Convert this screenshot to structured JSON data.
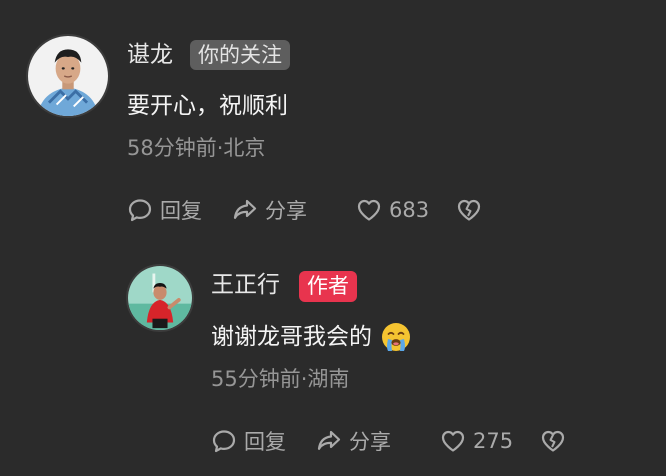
{
  "comments": [
    {
      "user_name": "谌龙",
      "badge": "你的关注",
      "text": "要开心，祝顺利",
      "time": "58分钟前",
      "location": "北京",
      "actions": {
        "reply_label": "回复",
        "share_label": "分享",
        "like_count": "683"
      }
    }
  ],
  "replies": [
    {
      "user_name": "王正行",
      "badge": "作者",
      "text": "谢谢龙哥我会的",
      "emoji_icon": "crying-face-icon",
      "time": "55分钟前",
      "location": "湖南",
      "actions": {
        "reply_label": "回复",
        "share_label": "分享",
        "like_count": "275"
      }
    }
  ],
  "colors": {
    "background": "#2b2b2b",
    "author_badge": "#e8344e",
    "follow_badge": "#5e5e5e",
    "meta_text": "#969696"
  }
}
